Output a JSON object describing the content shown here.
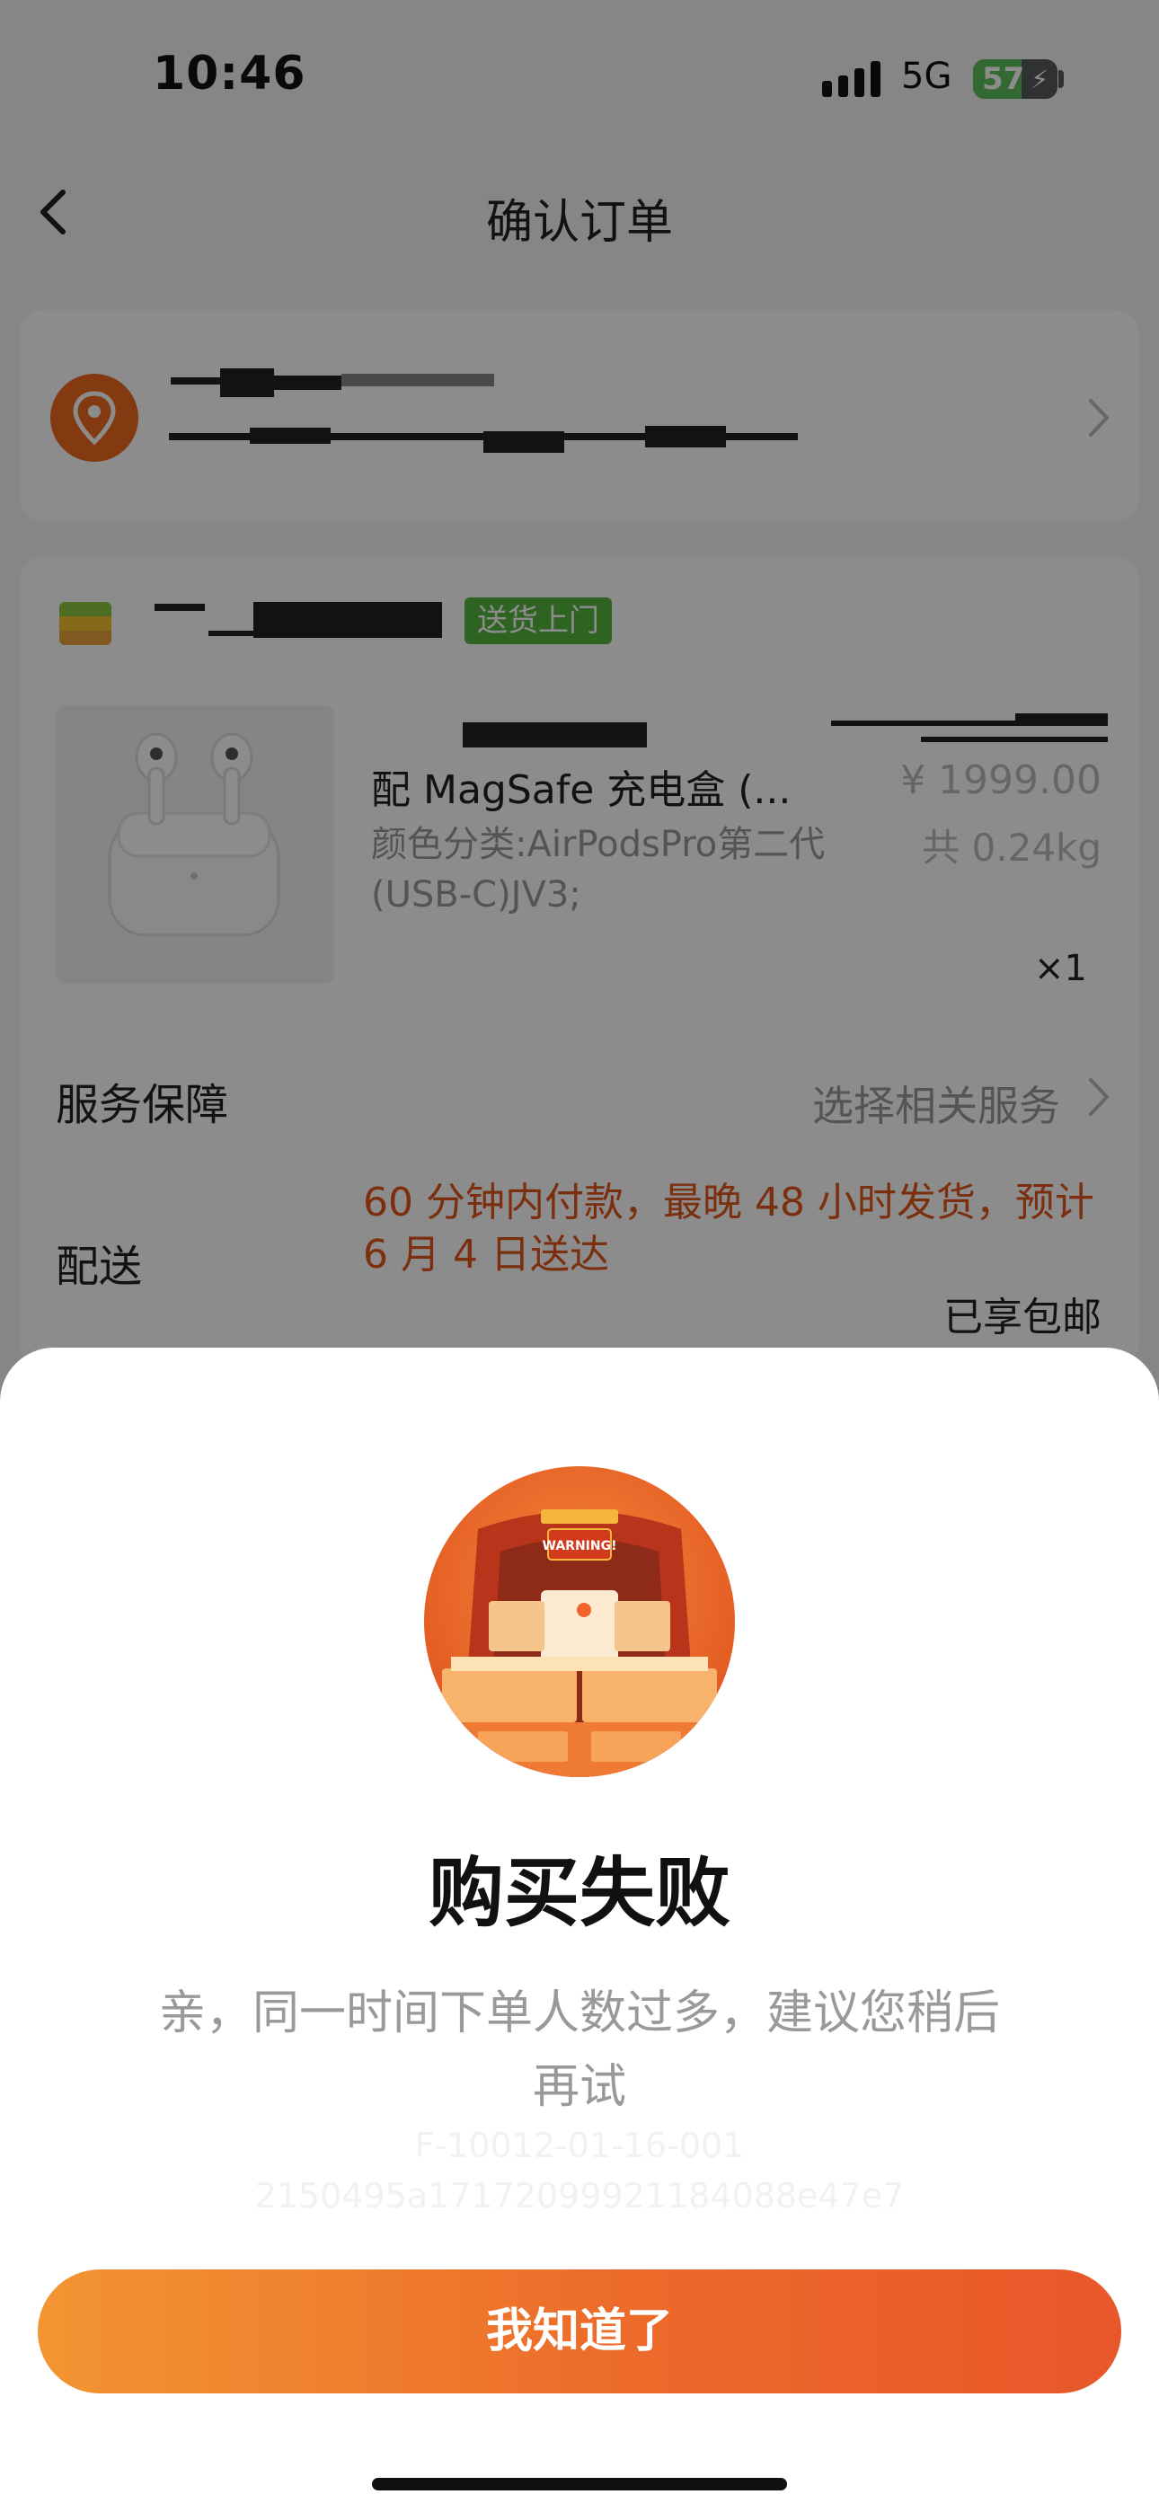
{
  "status_bar": {
    "time": "10:46",
    "network": "5G",
    "battery_percent": 57,
    "battery_label": "57",
    "charging_icon": "bolt-icon"
  },
  "nav": {
    "back_icon": "chevron-left-icon",
    "title": "确认订单"
  },
  "address": {
    "icon": "location-pin-icon",
    "chevron_icon": "chevron-right-icon"
  },
  "order": {
    "store_icon": "store-flag-icon",
    "delivery_badge": "送货上门",
    "product": {
      "image": "airpods-pro-image",
      "name": "配 MagSafe 充电盒 (...",
      "sku": "颜色分类:AirPodsPro第二代(USB-C)JV3;",
      "price": "¥ 1999.00",
      "weight": "共 0.24kg",
      "quantity": "×1"
    },
    "service": {
      "label": "服务保障",
      "value": "选择相关服务"
    },
    "delivery": {
      "label": "配送",
      "text": "60 分钟内付款，最晚 48 小时发货，预计 6 月 4 日送达",
      "free_shipping": "已享包邮"
    }
  },
  "modal": {
    "illustration": "warning-delivery-truck-illustration",
    "illustration_text": "WARNING!",
    "title": "购买失败",
    "message": "亲，同一时间下单人数过多，建议您稍后再试",
    "code_line1": "F-10012-01-16-001",
    "code_line2": "2150495a17172099921184088e47e7",
    "button": "我知道了"
  },
  "colors": {
    "accent_orange": "#ec6a2a",
    "badge_green": "#56b53d",
    "warning_text": "#e0561a"
  }
}
